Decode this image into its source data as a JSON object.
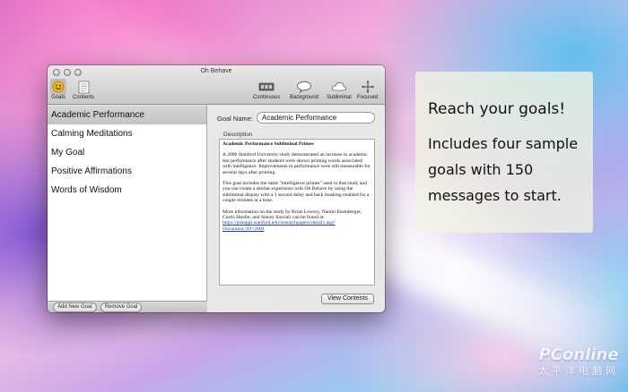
{
  "window": {
    "title": "Oh Behave",
    "toolbar": {
      "goals": {
        "label": "Goals",
        "icon": "smiley-icon"
      },
      "contents": {
        "label": "Contents",
        "icon": "document-icon"
      },
      "continuous": {
        "label": "Continuous",
        "icon": "film-strip-icon"
      },
      "background": {
        "label": "Background",
        "icon": "speech-bubble-icon"
      },
      "subliminal": {
        "label": "Subliminal",
        "icon": "cloud-icon"
      },
      "focused": {
        "label": "Focused",
        "icon": "crosshair-arrows-icon"
      }
    }
  },
  "sidebar": {
    "items": [
      {
        "label": "Academic Performance",
        "selected": true
      },
      {
        "label": "Calming Meditations",
        "selected": false
      },
      {
        "label": "My Goal",
        "selected": false
      },
      {
        "label": "Positive Affirmations",
        "selected": false
      },
      {
        "label": "Words of Wisdom",
        "selected": false
      }
    ],
    "add_button": "Add New Goal",
    "remove_button": "Remove Goal"
  },
  "main": {
    "goal_name_label": "Goal Name:",
    "goal_name_value": "Academic Performance",
    "description_label": "Description",
    "description": {
      "heading": "Academic Performance Subliminal Primes",
      "p1": "A 2006 Stanford University study demonstrated an increase in academic test performance after students were shown priming words associated with intelligence. Improvements in performance were still measurable for several days after priming.",
      "p2": "This goal includes the same \"intelligence primes\" used in that study and you can create a similar experience with Oh Behave by using the subliminal display with a 1 second delay and back masking enabled for a couple minutes at a time.",
      "p3": "More information on the study by Brian Lowery, Naomi Eisenberger, Curtis Hardin, and Stacey Sinclair can be found at:",
      "link": "https://psbapps.stanford.edu/researchpapers/detail1.asp?Document_ID=2860"
    },
    "view_button": "View Contents"
  },
  "callout": {
    "line1": "Reach your goals!",
    "line2": "Includes four sample goals with 150 messages to start."
  },
  "watermark": {
    "text": "PConline",
    "sub": "太平洋电脑网"
  },
  "colors": {
    "selection": "#c9c9c9",
    "link": "#1d3fbf",
    "callout_bg": "#eef3e0"
  }
}
